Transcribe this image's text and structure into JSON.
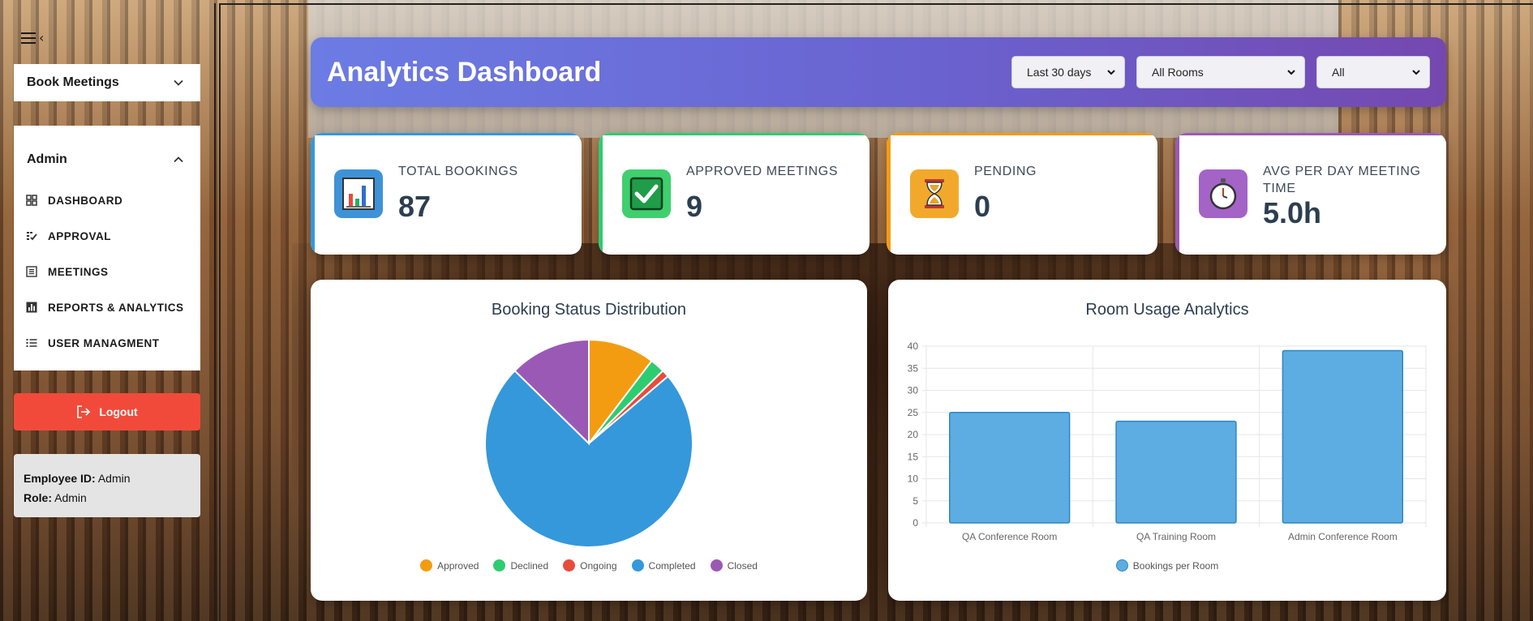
{
  "sidebar": {
    "book_meetings": "Book Meetings",
    "admin": "Admin",
    "nav": [
      {
        "label": "DASHBOARD",
        "icon": "grid-icon"
      },
      {
        "label": "APPROVAL",
        "icon": "approval-icon"
      },
      {
        "label": "MEETINGS",
        "icon": "list-box-icon"
      },
      {
        "label": "REPORTS & ANALYTICS",
        "icon": "bar-chart-icon"
      },
      {
        "label": "USER MANAGMENT",
        "icon": "list-icon"
      }
    ],
    "logout": "Logout",
    "employee_id_label": "Employee ID:",
    "employee_id": "Admin",
    "role_label": "Role:",
    "role": "Admin"
  },
  "header": {
    "title": "Analytics Dashboard",
    "filters": {
      "period": "Last 30 days",
      "room": "All Rooms",
      "status": "All"
    }
  },
  "stats": [
    {
      "label": "TOTAL BOOKINGS",
      "value": "87",
      "icon": "bar-chart-icon",
      "color": "#3498db"
    },
    {
      "label": "APPROVED MEETINGS",
      "value": "9",
      "icon": "check-icon",
      "color": "#2ecc71"
    },
    {
      "label": "PENDING",
      "value": "0",
      "icon": "hourglass-icon",
      "color": "#f39c12"
    },
    {
      "label": "AVG PER DAY MEETING TIME",
      "value": "5.0h",
      "icon": "stopwatch-icon",
      "color": "#9b59b6"
    }
  ],
  "chart_data": [
    {
      "type": "pie",
      "title": "Booking Status Distribution",
      "labels": [
        "Approved",
        "Declined",
        "Ongoing",
        "Completed",
        "Closed"
      ],
      "values": [
        9,
        2,
        1,
        64,
        11
      ],
      "colors": [
        "#f39c12",
        "#2ecc71",
        "#e74c3c",
        "#3498db",
        "#9b59b6"
      ],
      "legend": "bottom"
    },
    {
      "type": "bar",
      "title": "Room Usage Analytics",
      "categories": [
        "QA Conference Room",
        "QA Training Room",
        "Admin Conference Room"
      ],
      "series": [
        {
          "name": "Bookings per Room",
          "values": [
            25,
            23,
            39
          ]
        }
      ],
      "ylim": [
        0,
        40
      ],
      "yticks": [
        0,
        5,
        10,
        15,
        20,
        25,
        30,
        35,
        40
      ],
      "colors": [
        "#5dade2",
        "#2e86c1"
      ],
      "grid": true,
      "legend": "bottom"
    }
  ]
}
